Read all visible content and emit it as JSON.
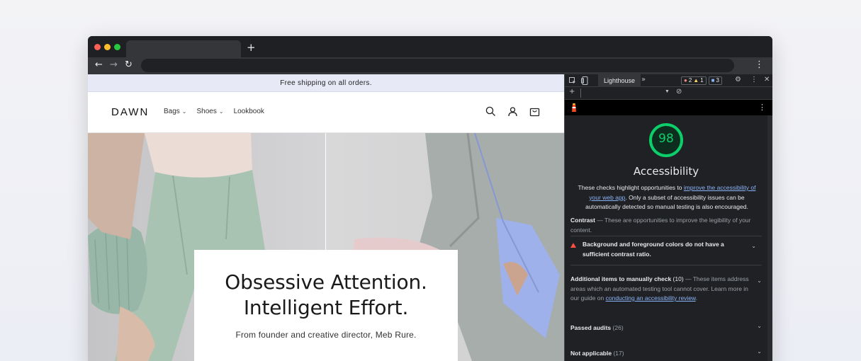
{
  "browser": {
    "new_tab_symbol": "+",
    "back_symbol": "←",
    "forward_symbol": "→",
    "reload_symbol": "↻",
    "menu_symbol": "⋮"
  },
  "store": {
    "announcement": "Free shipping on all orders.",
    "logo": "DAWN",
    "nav": [
      {
        "label": "Bags",
        "has_dropdown": true
      },
      {
        "label": "Shoes",
        "has_dropdown": true
      },
      {
        "label": "Lookbook",
        "has_dropdown": false
      }
    ],
    "header_icons": [
      "search-icon",
      "account-icon",
      "cart-icon"
    ],
    "hero": {
      "headline_line1": "Obsessive Attention.",
      "headline_line2": "Intelligent Effort.",
      "subheading": "From founder and creative director, Meb Rure."
    }
  },
  "devtools": {
    "active_tab": "Lighthouse",
    "more_tabs_symbol": "»",
    "errors": "2",
    "warnings": "1",
    "messages": "3",
    "add_symbol": "+",
    "report": {
      "score": 98,
      "score_color": "#0cce6b",
      "category": "Accessibility",
      "desc_prefix": "These checks highlight opportunities to ",
      "desc_link": "improve the accessibility of your web app",
      "desc_suffix": ". Only a subset of accessibility issues can be automatically detected so manual testing is also encouraged.",
      "contrast_title": "Contrast",
      "contrast_desc": " — These are opportunities to improve the legibility of your content.",
      "failed_audit": "Background and foreground colors do not have a sufficient contrast ratio.",
      "manual_title": "Additional items to manually check",
      "manual_count": " (10)",
      "manual_desc": " — These items address areas which an automated testing tool cannot cover. Learn more in our guide on ",
      "manual_link": "conducting an accessibility review",
      "manual_end": ".",
      "passed_label": "Passed audits",
      "passed_count": " (26)",
      "na_label": "Not applicable",
      "na_count": " (17)"
    }
  }
}
